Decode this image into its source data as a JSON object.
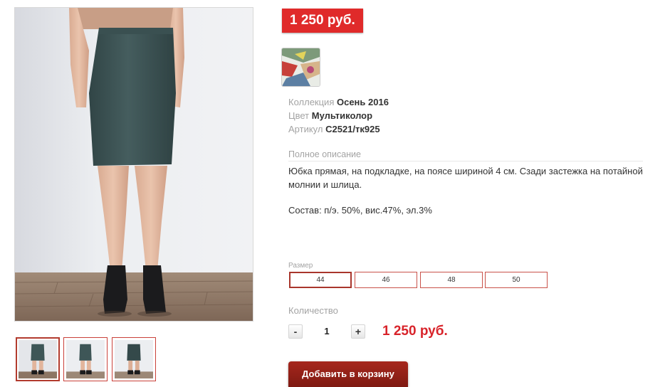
{
  "product": {
    "price_badge": "1 250 руб.",
    "properties": [
      {
        "label": "Коллекция",
        "value": "Осень 2016"
      },
      {
        "label": "Цвет",
        "value": "Мультиколор"
      },
      {
        "label": "Артикул",
        "value": "C2521/тк925"
      }
    ],
    "description_title": "Полное описание",
    "description": "Юбка прямая, на подкладке, на поясе шириной 4 см. Сзади застежка на потайной молнии и шлица.",
    "composition": "Состав: п/э. 50%, вис.47%, эл.3%"
  },
  "size": {
    "label": "Размер",
    "options": [
      "44",
      "46",
      "48",
      "50"
    ],
    "selected": "44"
  },
  "quantity": {
    "label": "Количество",
    "minus": "-",
    "plus": "+",
    "value": "1",
    "total": "1 250 руб."
  },
  "cart": {
    "add_label": "Добавить в корзину"
  },
  "gallery": {
    "thumbnail_count": 3,
    "selected_thumbnail": 1
  },
  "colors": {
    "price_red": "#e02a2a",
    "total_red": "#d8232a",
    "button_dark_red": "#8f1f16",
    "skirt": "#3e5657"
  },
  "icons": [
    "product-photo",
    "color-swatch-image"
  ]
}
